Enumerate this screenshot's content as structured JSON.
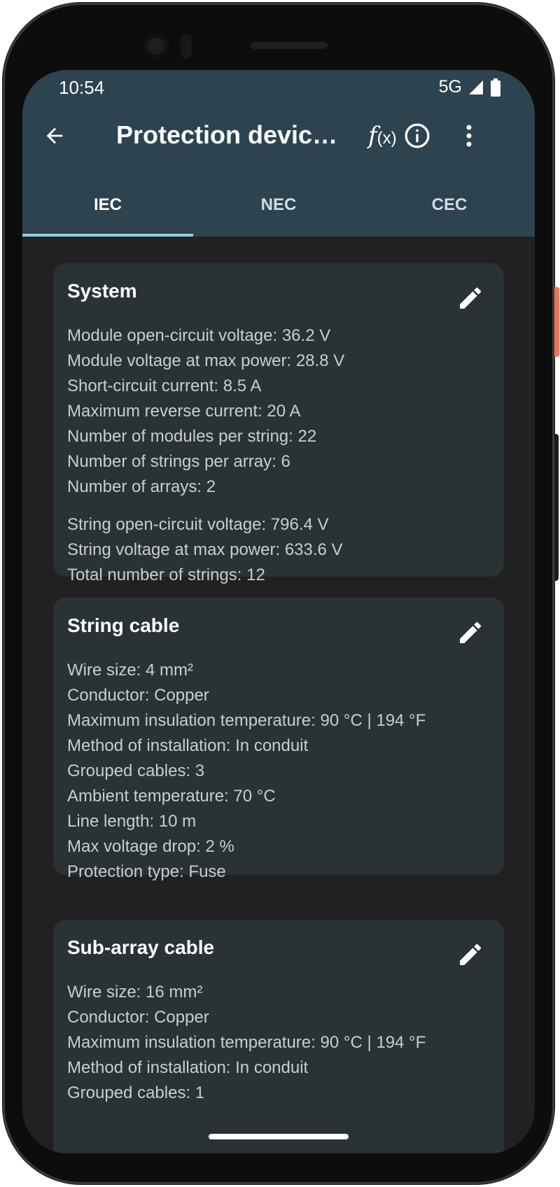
{
  "status_bar": {
    "time": "10:54",
    "network": "5G"
  },
  "toolbar": {
    "back_icon": "arrow-back-icon",
    "title": "Protection devic…",
    "formula_label": "f",
    "formula_sub": "(x)",
    "info_icon": "info-icon",
    "more_icon": "more-vert-icon"
  },
  "tabs": [
    {
      "label": "IEC",
      "active": true
    },
    {
      "label": "NEC",
      "active": false
    },
    {
      "label": "CEC",
      "active": false
    }
  ],
  "cards": {
    "system": {
      "title": "System",
      "lines": [
        "Module open-circuit voltage: 36.2 V",
        "Module voltage at max power: 28.8 V",
        "Short-circuit current: 8.5 A",
        "Maximum reverse current: 20 A",
        "Number of modules per string: 22",
        "Number of strings per array: 6",
        "Number of arrays: 2"
      ],
      "derived_lines": [
        "String open-circuit voltage: 796.4 V",
        "String voltage at max power: 633.6 V",
        "Total number of strings: 12"
      ]
    },
    "string_cable": {
      "title": "String cable",
      "lines": [
        "Wire size: 4 mm²",
        "Conductor: Copper",
        "Maximum insulation temperature: 90 °C | 194 °F",
        "Method of installation: In conduit",
        "Grouped cables: 3",
        "Ambient temperature: 70 °C",
        "Line length: 10 m",
        "Max voltage drop: 2 %",
        "Protection type: Fuse"
      ]
    },
    "sub_array_cable": {
      "title": "Sub-array cable",
      "lines": [
        "Wire size: 16 mm²",
        "Conductor: Copper",
        "Maximum insulation temperature: 90 °C | 194 °F",
        "Method of installation: In conduit",
        "Grouped cables: 1"
      ]
    }
  },
  "colors": {
    "appbar": "#2d4350",
    "background": "#212121",
    "card": "#2a3236",
    "tab_indicator": "#8fd1e0"
  }
}
